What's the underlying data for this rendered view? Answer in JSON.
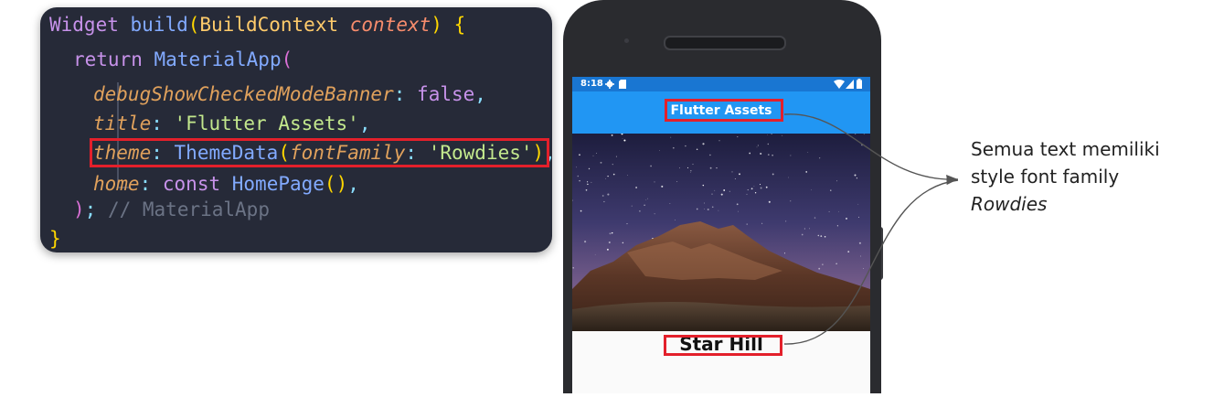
{
  "code": {
    "line1": {
      "kw": "Widget",
      "fn": "build",
      "open": "(",
      "type": "BuildContext",
      "param": "context",
      "close": ")",
      "brace": "{"
    },
    "line2": {
      "kw": "return",
      "cls": "MaterialApp",
      "open": "("
    },
    "line3": {
      "prop": "debugShowCheckedModeBanner",
      "colon": ":",
      "val": "false",
      "comma": ","
    },
    "line4": {
      "prop": "title",
      "colon": ":",
      "val": "'Flutter Assets'",
      "comma": ","
    },
    "line5": {
      "prop": "theme",
      "colon": ":",
      "cls": "ThemeData",
      "open": "(",
      "param": "fontFamily",
      "colon2": ":",
      "val": "'Rowdies'",
      "close": ")",
      "comma": ","
    },
    "line6": {
      "prop": "home",
      "colon": ":",
      "kw": "const",
      "cls": "HomePage",
      "parens": "()",
      "comma": ","
    },
    "line7": {
      "close": ")",
      "semi": ";",
      "comment": "// MaterialApp"
    },
    "line8": {
      "brace": "}"
    }
  },
  "phone": {
    "status_time": "8:18",
    "app_title": "Flutter Assets",
    "body_title": "Star Hill",
    "status_icons": [
      "settings-icon",
      "sd-card-icon",
      "wifi-icon",
      "signal-icon",
      "battery-icon"
    ]
  },
  "annotation": {
    "line1": "Semua text memiliki",
    "line2": "style font family",
    "line3": "Rowdies"
  },
  "colors": {
    "highlight": "#e3202b",
    "app_bar": "#2196f3",
    "status_bar": "#1976d2",
    "code_bg": "#262a38"
  }
}
